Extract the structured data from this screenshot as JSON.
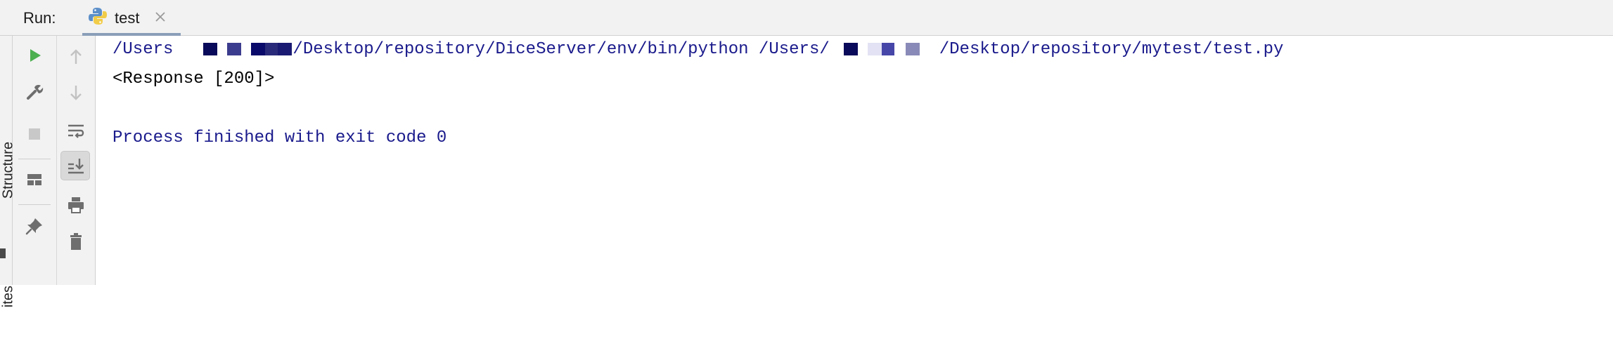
{
  "header": {
    "run_label": "Run:",
    "tab": {
      "label": "test",
      "icon": "python-file-icon",
      "close_icon": "close-icon"
    }
  },
  "side_panel": {
    "structure_label": "Structure",
    "favorites_label": "ites"
  },
  "toolbar_left": [
    {
      "name": "rerun-button",
      "icon": "run-icon"
    },
    {
      "name": "edit-configuration-button",
      "icon": "wrench-icon"
    },
    {
      "name": "stop-button",
      "icon": "stop-icon"
    },
    {
      "name": "restore-layout-button",
      "icon": "layout-icon"
    },
    {
      "name": "pin-tab-button",
      "icon": "pin-icon"
    }
  ],
  "toolbar_right": [
    {
      "name": "up-stack-button",
      "icon": "arrow-up-icon"
    },
    {
      "name": "down-stack-button",
      "icon": "arrow-down-icon"
    },
    {
      "name": "soft-wrap-button",
      "icon": "soft-wrap-icon"
    },
    {
      "name": "scroll-to-end-button",
      "icon": "scroll-to-end-icon",
      "pressed": true
    },
    {
      "name": "print-button",
      "icon": "print-icon"
    },
    {
      "name": "clear-all-button",
      "icon": "trash-icon"
    }
  ],
  "console": {
    "cmd_part1": "/Users",
    "cmd_part2": "/Desktop/repository/DiceServer/env/bin/python /Users/",
    "cmd_part3": "/Desktop/repository/mytest/test.py",
    "response_line": "<Response [200]>",
    "exit_line": "Process finished with exit code 0"
  },
  "colors": {
    "panel_bg": "#f2f2f2",
    "run_green": "#4caf50",
    "console_blue": "#1a1a8c",
    "tab_underline": "#8a9eb8"
  }
}
